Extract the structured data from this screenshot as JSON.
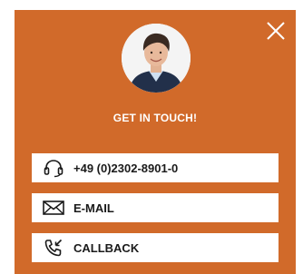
{
  "widget": {
    "title": "GET IN TOUCH!",
    "accent_color": "#d16a2a",
    "close_icon": "close-icon",
    "avatar_icon": "person-photo"
  },
  "contacts": [
    {
      "icon": "headset-icon",
      "label": "+49 (0)2302-8901-0"
    },
    {
      "icon": "envelope-icon",
      "label": "E-MAIL"
    },
    {
      "icon": "phone-callback-icon",
      "label": "CALLBACK"
    }
  ]
}
